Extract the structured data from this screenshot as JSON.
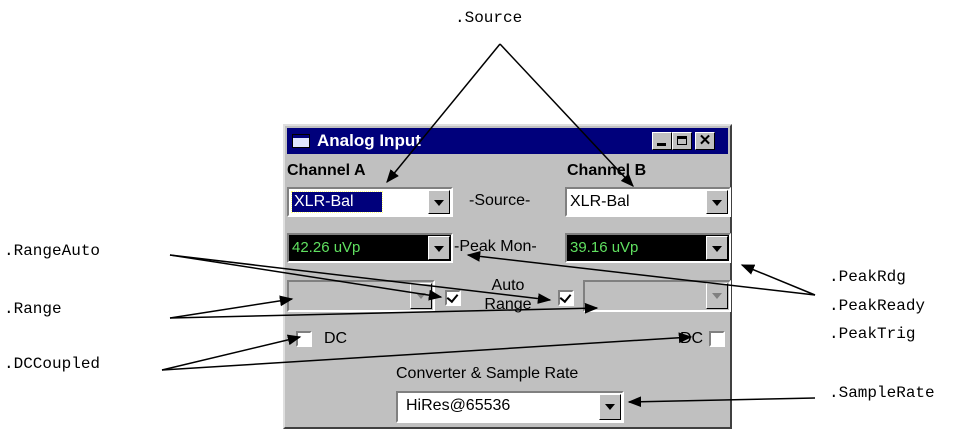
{
  "window": {
    "title": "Analog Input",
    "min_glyph": "_",
    "max_glyph": "□",
    "close_glyph": "✕"
  },
  "channels": {
    "a_label": "Channel A",
    "b_label": "Channel B"
  },
  "source": {
    "label": "-Source-",
    "a_value": "XLR-Bal",
    "b_value": "XLR-Bal"
  },
  "peak": {
    "label": "-Peak Mon-",
    "a_value": "42.26  uVp",
    "b_value": "39.16  uVp",
    "display_color": "#60e060"
  },
  "range": {
    "auto_label_line1": "Auto",
    "auto_label_line2": "Range",
    "a_auto_checked": true,
    "b_auto_checked": true
  },
  "dc": {
    "a_label": "DC",
    "b_label": "DC",
    "a_checked": false,
    "b_checked": false
  },
  "sample_rate": {
    "label": "Converter & Sample Rate",
    "value": "HiRes@65536"
  },
  "callouts": {
    "source": ".Source",
    "range_auto": ".RangeAuto",
    "range": ".Range",
    "dc_coupled": ".DCCoupled",
    "peak_rdg": ".PeakRdg",
    "peak_ready": ".PeakReady",
    "peak_trig": ".PeakTrig",
    "sample_rate": ".SampleRate"
  },
  "colors": {
    "titlebar": "#00007b",
    "face": "#c0c0c0",
    "selection": "#00007b"
  }
}
